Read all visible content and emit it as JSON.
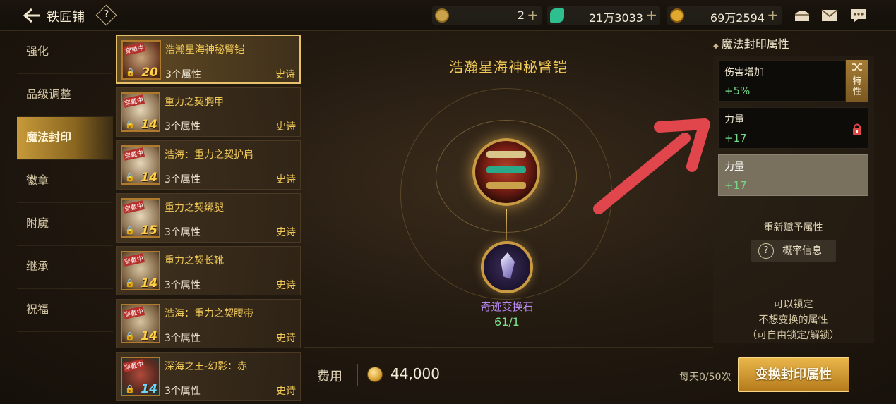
{
  "header": {
    "title": "铁匠铺",
    "help": "?",
    "currencies": [
      {
        "icon": "c-token-icon",
        "value": "2",
        "color": "#c9a24a"
      },
      {
        "icon": "green-gem-icon",
        "value": "21万3033",
        "color": "#2fbf8f"
      },
      {
        "icon": "gold-coin-icon",
        "value": "69万2594",
        "color": "#e0a92e"
      }
    ],
    "plus": "+",
    "icons": [
      "chest-icon",
      "mail-icon",
      "chat-icon"
    ]
  },
  "sidebar": {
    "items": [
      {
        "label": "强化"
      },
      {
        "label": "品级调整"
      },
      {
        "label": "魔法封印"
      },
      {
        "label": "徽章"
      },
      {
        "label": "附魔"
      },
      {
        "label": "继承"
      },
      {
        "label": "祝福"
      }
    ],
    "active_index": 2
  },
  "equipment": {
    "equipped_tag": "穿戴中",
    "items": [
      {
        "name": "浩瀚星海神秘臂铠",
        "attrs": "3个属性",
        "grade": "史诗",
        "level": "20"
      },
      {
        "name": "重力之契胸甲",
        "attrs": "3个属性",
        "grade": "史诗",
        "level": "14"
      },
      {
        "name": "浩海：重力之契护肩",
        "attrs": "3个属性",
        "grade": "史诗",
        "level": "14"
      },
      {
        "name": "重力之契绑腿",
        "attrs": "3个属性",
        "grade": "史诗",
        "level": "15"
      },
      {
        "name": "重力之契长靴",
        "attrs": "3个属性",
        "grade": "史诗",
        "level": "14"
      },
      {
        "name": "浩海：重力之契腰带",
        "attrs": "3个属性",
        "grade": "史诗",
        "level": "14"
      },
      {
        "name": "深海之王-幻影：赤",
        "attrs": "3个属性",
        "grade": "史诗",
        "level": "14"
      }
    ]
  },
  "center": {
    "item_name": "浩瀚星海神秘臂铠",
    "stone_name": "奇迹变换石",
    "stone_count": "61/1"
  },
  "cost": {
    "label": "费用",
    "value": "44,000",
    "daily": "每天0/50次",
    "button": "变换封印属性"
  },
  "right_panel": {
    "title": "魔法封印属性",
    "special_label": "特性",
    "attributes": [
      {
        "name": "伤害增加",
        "value": "+5%"
      },
      {
        "name": "力量",
        "value": "+17"
      },
      {
        "name": "力量",
        "value": "+17"
      }
    ],
    "reassign_label": "重新赋予属性",
    "prob_button": "概率信息",
    "tips": [
      "可以锁定",
      "不想变换的属性",
      "（可自由锁定/解锁）"
    ]
  }
}
